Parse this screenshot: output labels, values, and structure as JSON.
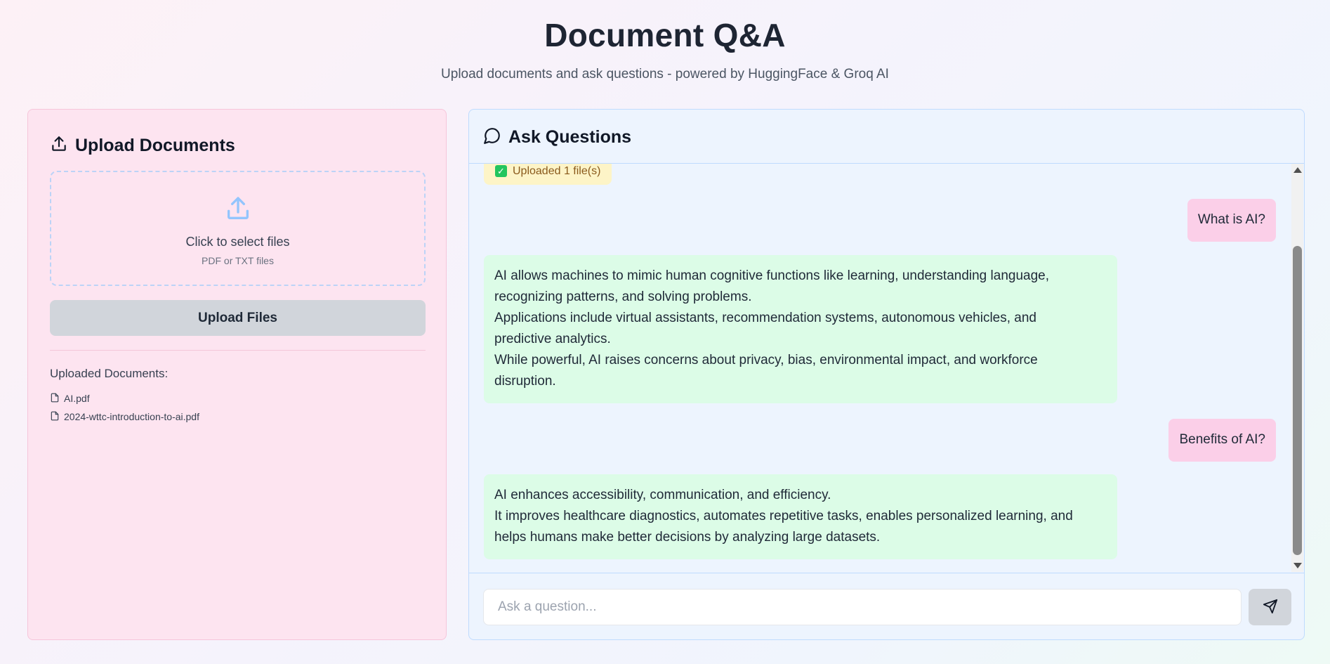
{
  "header": {
    "title": "Document Q&A",
    "subtitle": "Upload documents and ask questions - powered by HuggingFace & Groq AI"
  },
  "upload_panel": {
    "heading": "Upload Documents",
    "heading_icon": "upload-icon",
    "dropzone": {
      "icon": "upload-icon",
      "main_text": "Click to select files",
      "hint_text": "PDF or TXT files"
    },
    "upload_button_label": "Upload Files",
    "uploaded_title": "Uploaded Documents:",
    "documents": [
      {
        "name": "AI.pdf",
        "icon": "file-icon"
      },
      {
        "name": "2024-wttc-introduction-to-ai.pdf",
        "icon": "file-icon"
      }
    ]
  },
  "chat_panel": {
    "heading": "Ask Questions",
    "heading_icon": "chat-bubble-icon",
    "status_message": "Uploaded 1 file(s)",
    "messages": [
      {
        "role": "user",
        "text": "What is AI?"
      },
      {
        "role": "assistant",
        "lines": [
          "AI allows machines to mimic human cognitive functions like learning, understanding language,",
          "recognizing patterns, and solving problems.",
          "Applications include virtual assistants, recommendation systems, autonomous vehicles, and",
          "predictive analytics.",
          "While powerful, AI raises concerns about privacy, bias, environmental impact, and workforce",
          "disruption."
        ]
      },
      {
        "role": "user",
        "text": "Benefits of AI?"
      },
      {
        "role": "assistant",
        "lines": [
          "AI enhances accessibility, communication, and efficiency.",
          "It improves healthcare diagnostics, automates repetitive tasks, enables personalized learning, and",
          "helps humans make better decisions by analyzing large datasets."
        ]
      }
    ],
    "input": {
      "value": "",
      "placeholder": "Ask a question..."
    },
    "send_icon": "send-icon"
  },
  "colors": {
    "upload_panel_bg": "#fde4f0",
    "chat_panel_bg": "#edf4fe",
    "user_bubble": "#fbcfe8",
    "assistant_bubble": "#dcfce7",
    "status_bubble": "#fdf4c7",
    "button_gray": "#d1d5db",
    "accent_blue": "#93c5fd"
  }
}
